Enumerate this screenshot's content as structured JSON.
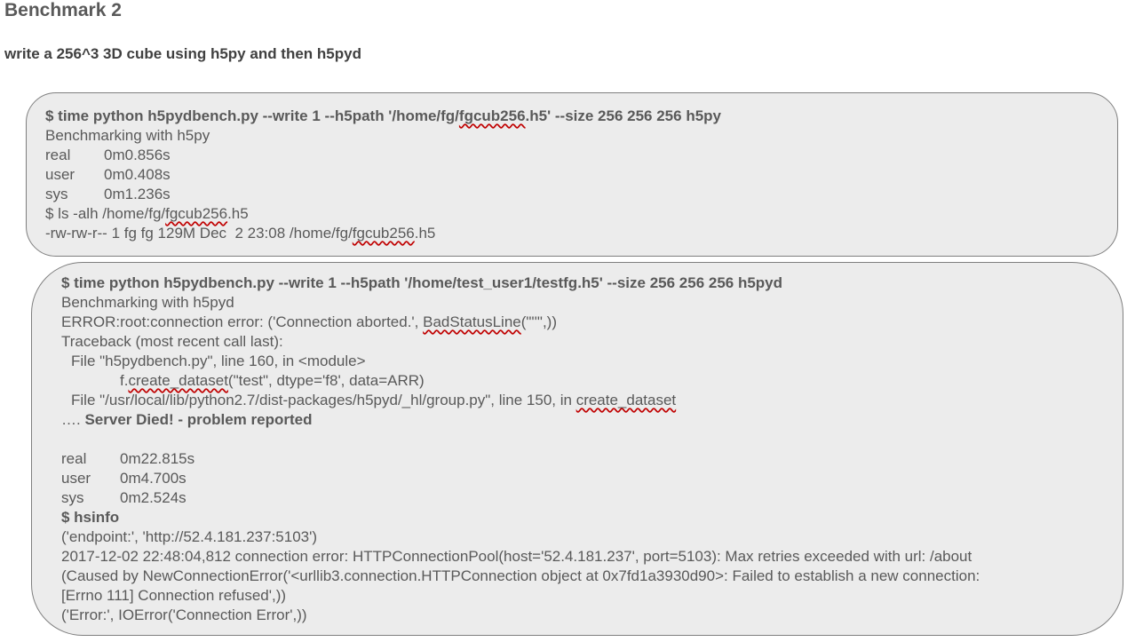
{
  "title": "Benchmark 2",
  "subtitle": "write a 256^3 3D cube using h5py and then h5pyd",
  "box1": {
    "cmd_a": "$ time python h5pydbench.py --write 1 --h5path '/home/fg/",
    "cmd_sq": "fgcub256",
    "cmd_b": ".h5' --size 256 256 256 h5py",
    "benchmarking": "Benchmarking with h5py",
    "timings": [
      {
        "label": "real",
        "value": "0m0.856s"
      },
      {
        "label": "user",
        "value": "0m0.408s"
      },
      {
        "label": "sys",
        "value": "0m1.236s"
      }
    ],
    "ls_a": "$ ls -alh /home/fg/",
    "ls_sq": "fgcub256",
    "ls_b": ".h5",
    "ls_out_a": "-rw-rw-r-- 1 fg fg 129M Dec  2 23:08 /home/fg/",
    "ls_out_sq": "fgcub256",
    "ls_out_b": ".h5"
  },
  "box2": {
    "cmd": "$ time python h5pydbench.py --write 1 --h5path '/home/test_user1/testfg.h5' --size 256 256 256 h5pyd",
    "benchmarking": "Benchmarking with h5pyd",
    "error_a": "ERROR:root:connection error: ('Connection aborted.', ",
    "error_sq": "BadStatusLine",
    "error_b": "(\"''\",))",
    "traceback": "Traceback (most recent call last):",
    "file1": "File \"h5pydbench.py\", line 160, in <module>",
    "code_a": "f.",
    "code_sq": "create_dataset",
    "code_b": "(\"test\", dtype='f8', data=ARR)",
    "file2_a": "File \"/usr/local/lib/python2.7/dist-packages/h5pyd/_hl/group.py\", line 150, in ",
    "file2_sq": "create_dataset",
    "died_prefix": "…. ",
    "died_bold": "Server Died! - problem reported",
    "timings": [
      {
        "label": "real",
        "value": "0m22.815s"
      },
      {
        "label": "user",
        "value": "0m4.700s"
      },
      {
        "label": "sys",
        "value": "0m2.524s"
      }
    ],
    "hsinfo_cmd": "$ hsinfo",
    "hsinfo_lines": [
      "('endpoint:', 'http://52.4.181.237:5103')",
      "2017-12-02 22:48:04,812 connection error: HTTPConnectionPool(host='52.4.181.237', port=5103): Max retries exceeded with url: /about",
      "(Caused by NewConnectionError('<urllib3.connection.HTTPConnection object at 0x7fd1a3930d90>: Failed to establish a new connection:",
      "[Errno 111] Connection refused',))",
      "('Error:', IOError('Connection Error',))"
    ]
  },
  "colors": {
    "text": "#595959",
    "box_fill": "#ececec",
    "box_border": "#7f7f7f",
    "spellcheck": "#c00000"
  }
}
